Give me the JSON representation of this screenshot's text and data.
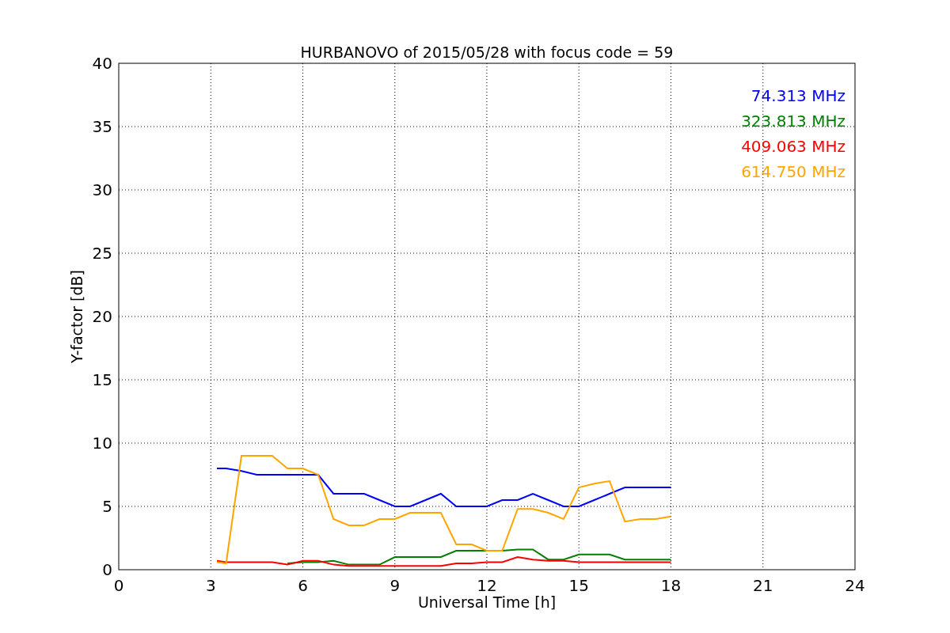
{
  "chart_data": {
    "type": "line",
    "title": "HURBANOVO of 2015/05/28 with focus code = 59",
    "xlabel": "Universal Time [h]",
    "ylabel": "Y-factor [dB]",
    "x": [
      3.2,
      3.5,
      4,
      4.5,
      5,
      5.5,
      6,
      6.5,
      7,
      7.5,
      8,
      8.5,
      9,
      9.5,
      10,
      10.5,
      11,
      11.5,
      12,
      12.5,
      13,
      13.5,
      14,
      14.5,
      15,
      15.5,
      16,
      16.5,
      17,
      17.5,
      18
    ],
    "series": [
      {
        "name": "74.313 MHz",
        "color": "#0000ff",
        "values": [
          8,
          8,
          7.8,
          7.5,
          7.5,
          7.5,
          7.5,
          7.5,
          6,
          6,
          6,
          5.5,
          5,
          5,
          5.5,
          6,
          5,
          5,
          5,
          5.5,
          5.5,
          6,
          5.5,
          5,
          5,
          5.5,
          6,
          6.5,
          6.5,
          6.5,
          6.5
        ]
      },
      {
        "name": "323.813 MHz",
        "color": "#008000",
        "values": [
          null,
          null,
          null,
          null,
          null,
          0.5,
          0.6,
          0.6,
          0.7,
          0.4,
          0.4,
          0.4,
          1,
          1,
          1,
          1,
          1.5,
          1.5,
          1.5,
          1.5,
          1.6,
          1.6,
          0.8,
          0.8,
          1.2,
          1.2,
          1.2,
          0.8,
          0.8,
          0.8,
          0.8
        ]
      },
      {
        "name": "409.063 MHz",
        "color": "#ff0000",
        "values": [
          0.7,
          0.6,
          0.6,
          0.6,
          0.6,
          0.4,
          0.7,
          0.7,
          0.4,
          0.3,
          0.3,
          0.3,
          0.3,
          0.3,
          0.3,
          0.3,
          0.5,
          0.5,
          0.6,
          0.6,
          1,
          0.8,
          0.7,
          0.7,
          0.6,
          0.6,
          0.6,
          0.6,
          0.6,
          0.6,
          0.6
        ]
      },
      {
        "name": "614.750 MHz",
        "color": "#ffa500",
        "values": [
          0.6,
          0.5,
          9,
          9,
          9,
          8,
          8,
          7.5,
          4,
          3.5,
          3.5,
          4,
          4,
          4.5,
          4.5,
          4.5,
          2,
          2,
          1.5,
          1.5,
          4.8,
          4.8,
          4.5,
          4,
          6.5,
          6.8,
          7,
          3.8,
          4,
          4,
          4.2
        ]
      }
    ],
    "grid": true,
    "xlim": [
      0,
      24
    ],
    "ylim": [
      0,
      40
    ],
    "xticks": [
      0,
      3,
      6,
      9,
      12,
      15,
      18,
      21,
      24
    ],
    "yticks": [
      0,
      5,
      10,
      15,
      20,
      25,
      30,
      35,
      40
    ]
  }
}
